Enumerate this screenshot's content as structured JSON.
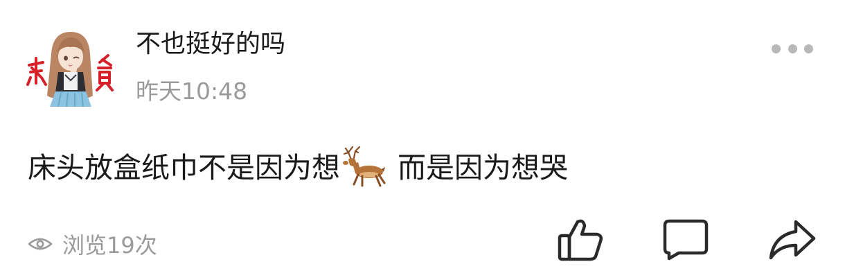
{
  "post": {
    "author": {
      "name": "不也挺好的吗"
    },
    "timestamp": "昨天10:48",
    "content": {
      "before_emoji": "床头放盒纸巾不是因为想",
      "emoji": "deer-emoji",
      "after_emoji": "而是因为想哭"
    },
    "views": "浏览19次"
  },
  "icons": {
    "more": "more-dots-icon",
    "eye": "eye-icon",
    "like": "thumbs-up-icon",
    "comment": "comment-icon",
    "share": "share-arrow-icon"
  },
  "colors": {
    "text": "#1a1a1a",
    "muted": "#9a9a9a",
    "icon": "#2a2a2a",
    "dots": "#b8b8b8"
  }
}
